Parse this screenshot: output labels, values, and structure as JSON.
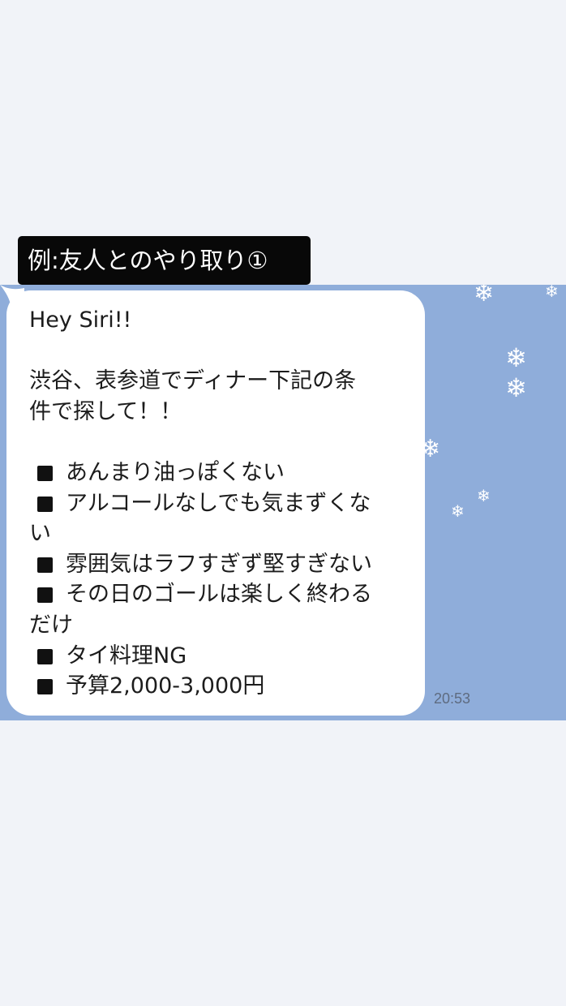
{
  "label": "例:友人とのやり取り①",
  "chat": {
    "background_color": "#8fadda",
    "bubble_color": "#ffffff",
    "message": {
      "lines": [
        "Hey Siri!!",
        "",
        "渋谷、表参道でディナー下記の条",
        "件で探して！！",
        ""
      ],
      "bullets": [
        {
          "text": "あんまり油っぽくない",
          "continuation": ""
        },
        {
          "text": "アルコールなしでも気まずくな",
          "continuation": "い"
        },
        {
          "text": "雰囲気はラフすぎず堅すぎない",
          "continuation": ""
        },
        {
          "text": "その日のゴールは楽しく終わる",
          "continuation": "だけ"
        },
        {
          "text": "タイ料理NG",
          "continuation": ""
        },
        {
          "text": "予算2,000-3,000円",
          "continuation": ""
        }
      ]
    },
    "timestamp": "20:53",
    "snowflake_icon": "❄"
  }
}
